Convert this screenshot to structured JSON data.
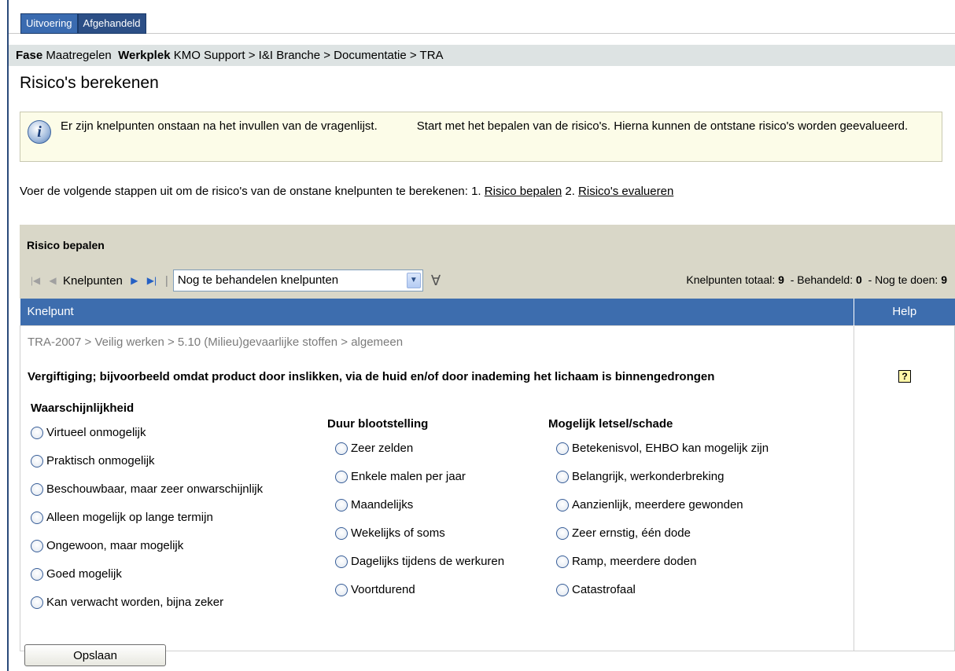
{
  "tabs": [
    {
      "label": "Uitvoering",
      "active": true
    },
    {
      "label": "Afgehandeld",
      "active": false
    }
  ],
  "breadcrumb": {
    "fase_label": "Fase",
    "fase_value": "Maatregelen",
    "werkplek_label": "Werkplek",
    "werkplek_value": "KMO Support > I&I Branche > Documentatie > TRA"
  },
  "page_title": "Risico's berekenen",
  "info": {
    "icon": "info-icon",
    "text": "Er zijn knelpunten onstaan na het invullen van de vragenlijst.            Start met het bepalen van de risico's. Hierna kunnen de ontstane risico's worden geevalueerd."
  },
  "steps": {
    "intro": "Voer de volgende stappen uit om de risico's van de onstane knelpunten te berekenen: 1.",
    "step1": "Risico bepalen",
    "mid": "2.",
    "step2": "Risico's evalueren"
  },
  "panel": {
    "title": "Risico bepalen",
    "nav_label": "Knelpunten",
    "filter_select": "Nog te behandelen knelpunten",
    "totals": {
      "totaal_label": "Knelpunten totaal:",
      "totaal_value": "9",
      "behandeld_label": "- Behandeld:",
      "behandeld_value": "0",
      "todo_label": "- Nog te doen:",
      "todo_value": "9"
    }
  },
  "table": {
    "col_knelpunt": "Knelpunt",
    "col_help": "Help",
    "path": "TRA-2007 > Veilig werken > 5.10 (Milieu)gevaarlijke stoffen > algemeen",
    "description": "Vergiftiging; bijvoorbeeld omdat product door inslikken, via de huid en/of door inademing het lichaam is binnengedrongen",
    "help_icon": "?",
    "waarschijnlijkheid": {
      "title": "Waarschijnlijkheid",
      "options": [
        "Virtueel onmogelijk",
        "Praktisch onmogelijk",
        "Beschouwbaar, maar zeer onwarschijnlijk",
        "Alleen mogelijk op lange termijn",
        "Ongewoon, maar mogelijk",
        "Goed mogelijk",
        "Kan verwacht worden, bijna zeker"
      ]
    },
    "duur": {
      "title": "Duur blootstelling",
      "options": [
        "Zeer zelden",
        "Enkele malen per jaar",
        "Maandelijks",
        "Wekelijks of soms",
        "Dagelijks tijdens de werkuren",
        "Voortdurend"
      ]
    },
    "letsel": {
      "title": "Mogelijk letsel/schade",
      "options": [
        "Betekenisvol, EHBO kan mogelijk zijn",
        "Belangrijk, werkonderbreking",
        "Aanzienlijk, meerdere gewonden",
        "Zeer ernstig, één dode",
        "Ramp, meerdere doden",
        "Catastrofaal"
      ]
    }
  },
  "save_label": "Opslaan"
}
